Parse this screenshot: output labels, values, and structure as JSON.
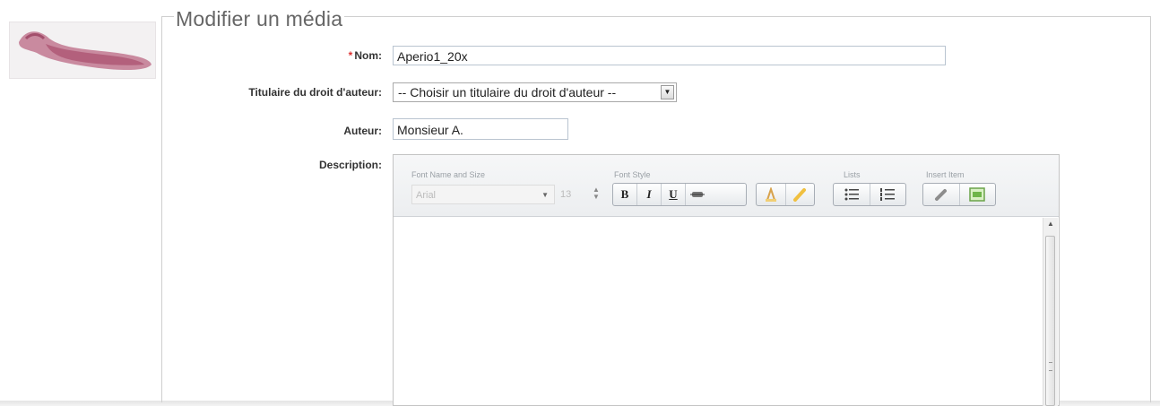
{
  "legend": "Modifier un média",
  "fields": {
    "nom": {
      "required_mark": "*",
      "label": "Nom:",
      "value": "Aperio1_20x"
    },
    "titulaire": {
      "label": "Titulaire du droit d'auteur:",
      "selected": "-- Choisir un titulaire du droit d'auteur --"
    },
    "auteur": {
      "label": "Auteur:",
      "value": "Monsieur A."
    },
    "description": {
      "label": "Description:"
    }
  },
  "toolbar": {
    "font_group_title": "Font Name and Size",
    "font_name": "Arial",
    "font_size": "13",
    "style_group_title": "Font Style",
    "bold": "B",
    "italic": "I",
    "underline": "U",
    "lists_group_title": "Lists",
    "insert_group_title": "Insert Item"
  },
  "icons": [
    "slide-thumbnail",
    "select-arrow-icon",
    "font-dropdown-icon",
    "size-spinner-icon",
    "strikethrough-icon",
    "text-color-icon",
    "highlight-icon",
    "bullet-list-icon",
    "numbered-list-icon",
    "link-icon",
    "image-icon",
    "scroll-up-icon"
  ],
  "colors": {
    "required": "#dd3333",
    "legend": "#666666"
  }
}
